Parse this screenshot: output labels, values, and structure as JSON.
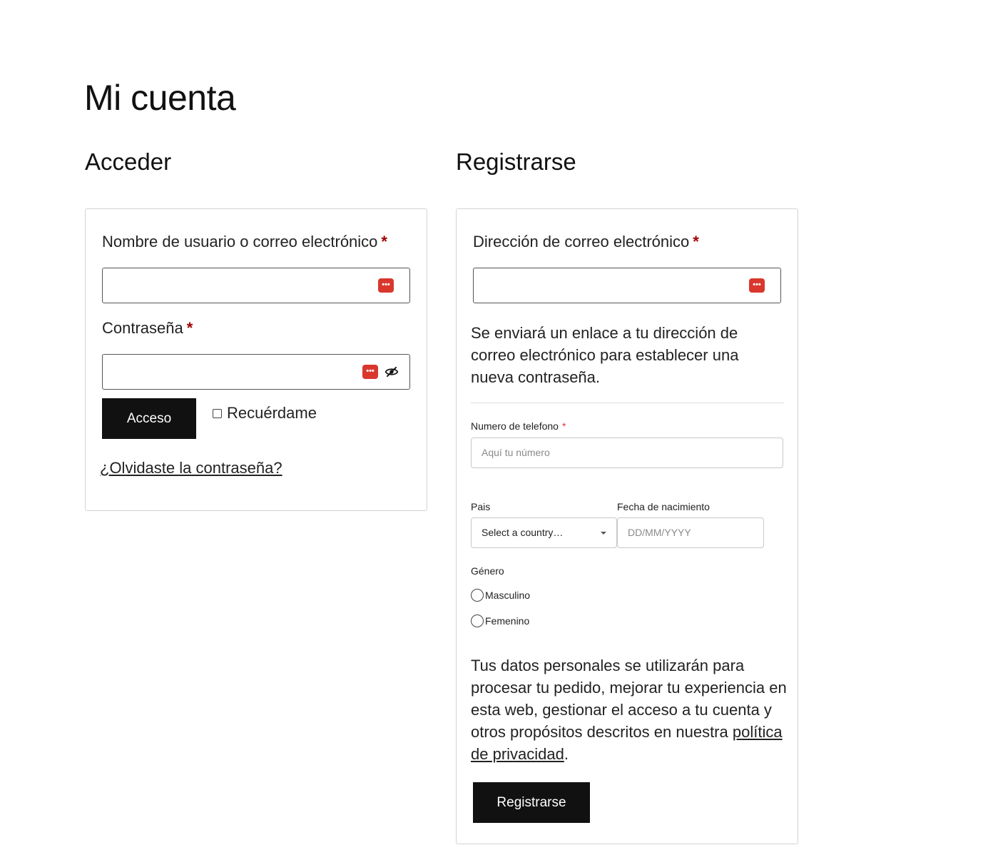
{
  "page": {
    "title": "Mi cuenta"
  },
  "login": {
    "heading": "Acceder",
    "username_label": "Nombre de usuario o correo electrónico",
    "password_label": "Contraseña",
    "required_mark": "*",
    "submit_label": "Acceso",
    "remember_label": "Recuérdame",
    "forgot_link": "¿Olvidaste la contraseña?",
    "password_manager_icon": "password-manager-icon",
    "toggle_visibility_icon": "eye-slash-icon"
  },
  "register": {
    "heading": "Registrarse",
    "email_label": "Dirección de correo electrónico",
    "required_mark": "*",
    "info_text": "Se enviará un enlace a tu dirección de correo electrónico para establecer una nueva contraseña.",
    "phone_label": "Numero de telefono",
    "phone_placeholder": "Aquí tu número",
    "country_label": "Pais",
    "country_value": "Select a country…",
    "birthdate_label": "Fecha de nacimiento",
    "birthdate_placeholder": "DD/MM/YYYY",
    "gender_label": "Género",
    "gender_options": [
      "Masculino",
      "Femenino"
    ],
    "privacy_text_before": "Tus datos personales se utilizarán para procesar tu pedido, mejorar tu experiencia en esta web, gestionar el acceso a tu cuenta y otros propósitos descritos en nuestra ",
    "privacy_link": "política de privacidad",
    "privacy_text_after": ".",
    "submit_label": "Registrarse"
  },
  "colors": {
    "required": "#a00000",
    "button_bg": "#111111",
    "password_manager": "#d9372d"
  }
}
